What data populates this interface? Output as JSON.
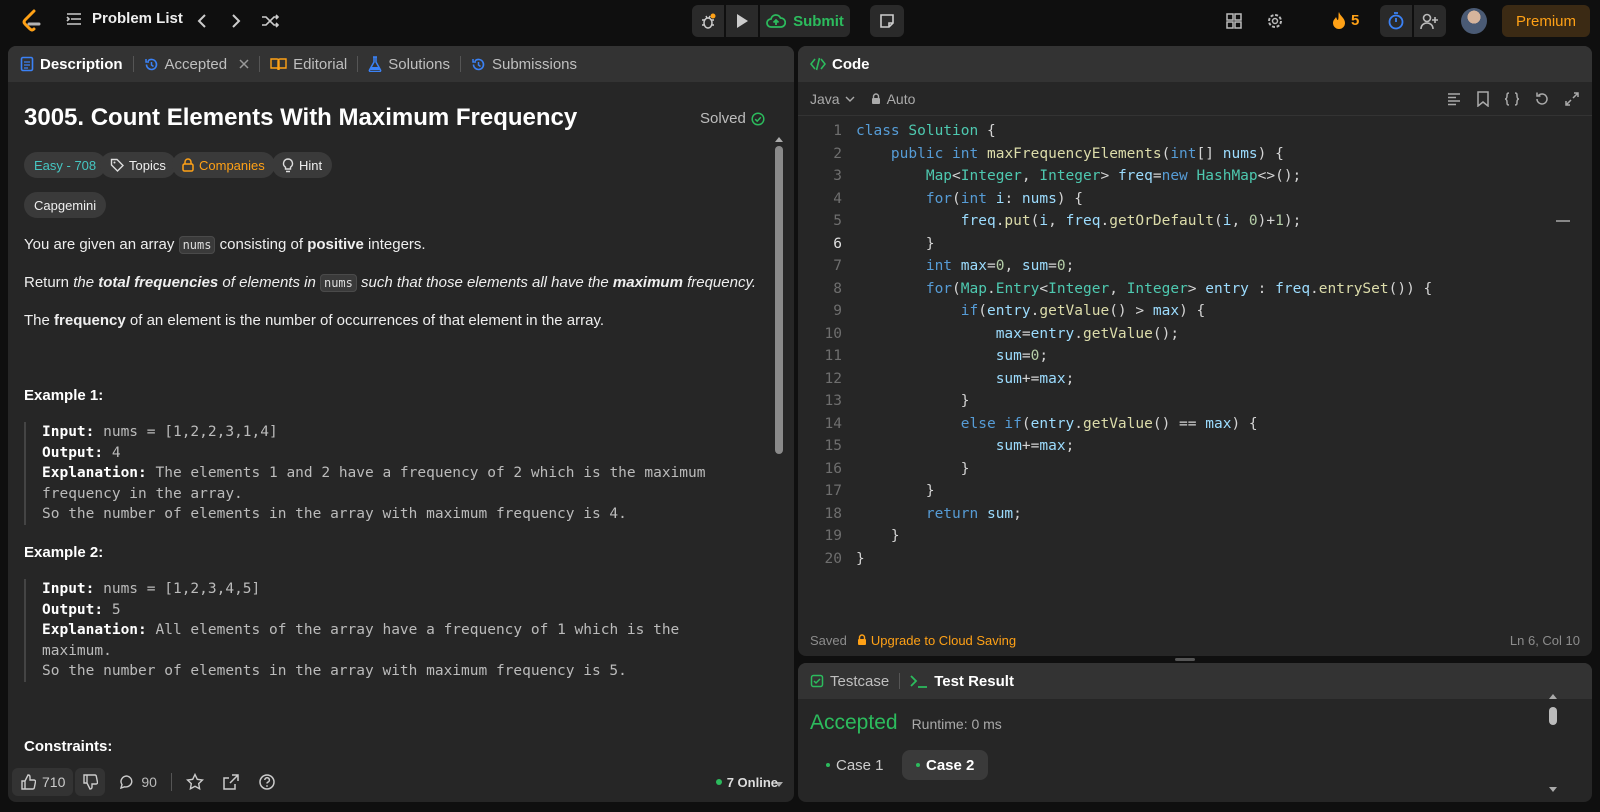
{
  "topbar": {
    "problem_list": "Problem List",
    "submit": "Submit",
    "streak": "5",
    "premium": "Premium"
  },
  "left_tabs": [
    {
      "label": "Description"
    },
    {
      "label": "Accepted"
    },
    {
      "label": "Editorial"
    },
    {
      "label": "Solutions"
    },
    {
      "label": "Submissions"
    }
  ],
  "problem": {
    "title": "3005. Count Elements With Maximum Frequency",
    "solved": "Solved",
    "difficulty": "Easy - 708",
    "topics": "Topics",
    "companies": "Companies",
    "hint": "Hint",
    "company_tag": "Capgemini",
    "p1_a": "You are given an array ",
    "p1_code": "nums",
    "p1_b": " consisting of ",
    "p1_bold": "positive",
    "p1_c": " integers.",
    "p2_a": "Return ",
    "p2_i": "the ",
    "p2_bi": "total frequencies",
    "p2_i2": " of elements in ",
    "p2_code": "nums",
    "p2_i3": " such that those elements all have the ",
    "p2_bi2": "maximum",
    "p2_i4": " frequency.",
    "p3_a": "The ",
    "p3_bold": "frequency",
    "p3_b": " of an element is the number of occurrences of that element in the array.",
    "ex1_title": "Example 1:",
    "ex1_input_label": "Input:",
    "ex1_input": " nums = [1,2,2,3,1,4]",
    "ex1_output_label": "Output:",
    "ex1_output": " 4",
    "ex1_expl_label": "Explanation:",
    "ex1_expl": " The elements 1 and 2 have a frequency of 2 which is the maximum\nfrequency in the array.\nSo the number of elements in the array with maximum frequency is 4.",
    "ex2_title": "Example 2:",
    "ex2_input_label": "Input:",
    "ex2_input": " nums = [1,2,3,4,5]",
    "ex2_output_label": "Output:",
    "ex2_output": " 5",
    "ex2_expl_label": "Explanation:",
    "ex2_expl": " All elements of the array have a frequency of 1 which is the\nmaximum.\nSo the number of elements in the array with maximum frequency is 5.",
    "constraints": "Constraints:"
  },
  "footer": {
    "likes": "710",
    "comments": "90",
    "online": "7 Online"
  },
  "code_panel": {
    "title": "Code",
    "language": "Java",
    "mode": "Auto",
    "saved": "Saved",
    "upgrade": "Upgrade to Cloud Saving",
    "cursor": "Ln 6, Col 10"
  },
  "code_lines": [
    "class Solution {",
    "    public int maxFrequencyElements(int[] nums) {",
    "        Map<Integer, Integer> freq=new HashMap<>();",
    "        for(int i: nums) {",
    "            freq.put(i, freq.getOrDefault(i, 0)+1);",
    "        }",
    "        int max=0, sum=0;",
    "        for(Map.Entry<Integer, Integer> entry : freq.entrySet()) {",
    "            if(entry.getValue() > max) {",
    "                max=entry.getValue();",
    "                sum=0;",
    "                sum+=max;",
    "            }",
    "            else if(entry.getValue() == max) {",
    "                sum+=max;",
    "            }",
    "        }",
    "        return sum;",
    "    }",
    "}"
  ],
  "result": {
    "tab_testcase": "Testcase",
    "tab_result": "Test Result",
    "status": "Accepted",
    "runtime": "Runtime: 0 ms",
    "case1": "Case 1",
    "case2": "Case 2"
  },
  "colors": {
    "accent": "#ffa116",
    "success": "#2cbb5d",
    "easy": "#46c6c2"
  }
}
